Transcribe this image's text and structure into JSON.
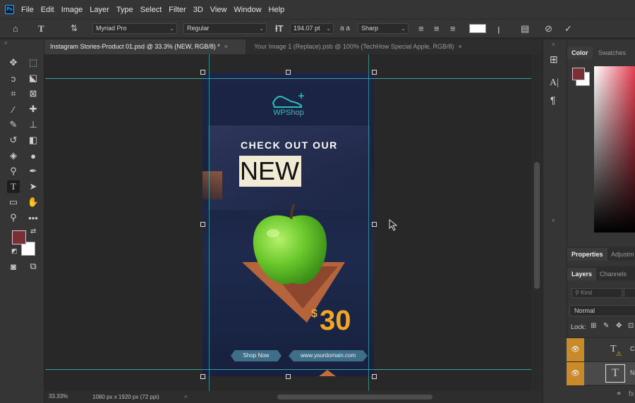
{
  "menubar": {
    "logo": "Ps",
    "items": [
      "File",
      "Edit",
      "Image",
      "Layer",
      "Type",
      "Select",
      "Filter",
      "3D",
      "View",
      "Window",
      "Help"
    ]
  },
  "options": {
    "font_family": "Myriad Pro",
    "font_style": "Regular",
    "font_size": "194.07 pt",
    "aa_label": "a a",
    "antialias": "Sharp"
  },
  "tabs": [
    {
      "label": "Instagram Stories-Product 01.psd @ 33.3% (NEW, RGB/8) *",
      "active": true
    },
    {
      "label": "Your Image 1 (Replace).psb @ 100% (TechHow Special Apple, RGB/8)",
      "active": false
    }
  ],
  "colors": {
    "foreground": "#7a2e35",
    "background": "#ffffff",
    "accent_orange": "#f4a623",
    "teal": "#27c3b8",
    "guide": "#3fc8c8"
  },
  "artboard": {
    "brand": "WPShop",
    "headline": "CHECK OUT OUR",
    "new_text": "NEW",
    "price_symbol": "$",
    "price": "30",
    "button_shop": "Shop Now",
    "button_url": "www.yourdomain.com"
  },
  "status": {
    "zoom": "33.33%",
    "doc_info": "1080 px x 1920 px (72 ppi)"
  },
  "panels": {
    "color_tabs": [
      "Color",
      "Swatches"
    ],
    "props_tabs": [
      "Properties",
      "Adjustm"
    ],
    "layer_tabs": [
      "Layers",
      "Channels"
    ],
    "kind_placeholder": "Kind",
    "blend_mode": "Normal",
    "lock_label": "Lock:",
    "layer_rows": [
      {
        "name": "C"
      },
      {
        "name": "N"
      }
    ]
  }
}
